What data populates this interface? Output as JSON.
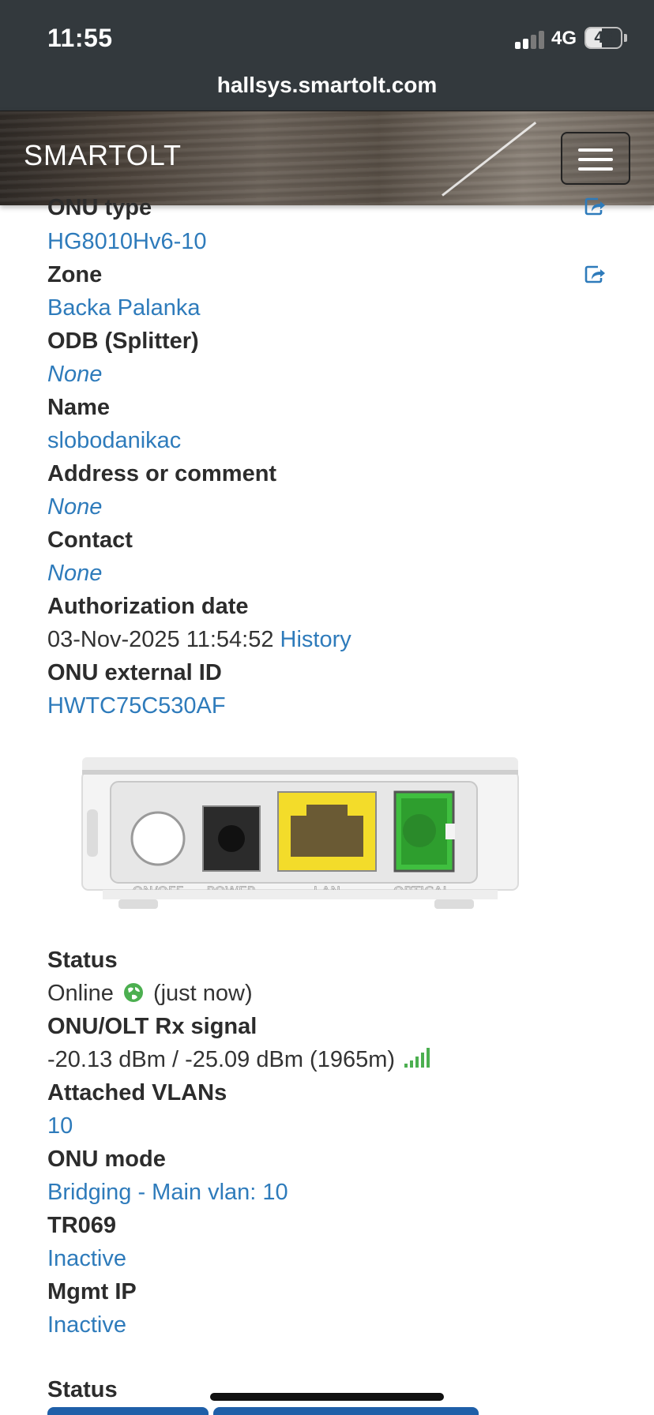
{
  "status_bar": {
    "time": "11:55",
    "network": "4G",
    "battery": "46",
    "battery_level": 0.46
  },
  "browser": {
    "url": "hallsys.smartolt.com"
  },
  "navbar": {
    "brand": "SMARTOLT"
  },
  "details": {
    "onu_type": {
      "label": "ONU type",
      "value": "HG8010Hv6-10"
    },
    "zone": {
      "label": "Zone",
      "value": "Backa Palanka"
    },
    "odb": {
      "label": "ODB (Splitter)",
      "value": "None"
    },
    "name": {
      "label": "Name",
      "value": "slobodanikac"
    },
    "address": {
      "label": "Address or comment",
      "value": "None"
    },
    "contact": {
      "label": "Contact",
      "value": "None"
    },
    "auth_date": {
      "label": "Authorization date",
      "value": "03-Nov-2025 11:54:52",
      "history_link": "History"
    },
    "external_id": {
      "label": "ONU external ID",
      "value": "HWTC75C530AF"
    }
  },
  "device_image": {
    "port_labels": [
      "ON/OFF",
      "POWER",
      "LAN",
      "OPTICAL"
    ]
  },
  "status": {
    "status": {
      "label": "Status",
      "value": "Online",
      "when": "(just now)"
    },
    "signal": {
      "label": "ONU/OLT Rx signal",
      "value": "-20.13 dBm / -25.09 dBm (1965m)"
    },
    "vlans": {
      "label": "Attached VLANs",
      "value": "10"
    },
    "mode": {
      "label": "ONU mode",
      "value": "Bridging - Main vlan: 10"
    },
    "tr069": {
      "label": "TR069",
      "value": "Inactive"
    },
    "mgmt_ip": {
      "label": "Mgmt IP",
      "value": "Inactive"
    }
  },
  "bottom_section": {
    "label": "Status"
  },
  "colors": {
    "link": "#2e7bbb",
    "online": "#4caf50",
    "chrome": "#33393d"
  },
  "icons": [
    "edit-share-icon",
    "globe-icon",
    "signal-bars-icon",
    "hamburger-icon"
  ]
}
